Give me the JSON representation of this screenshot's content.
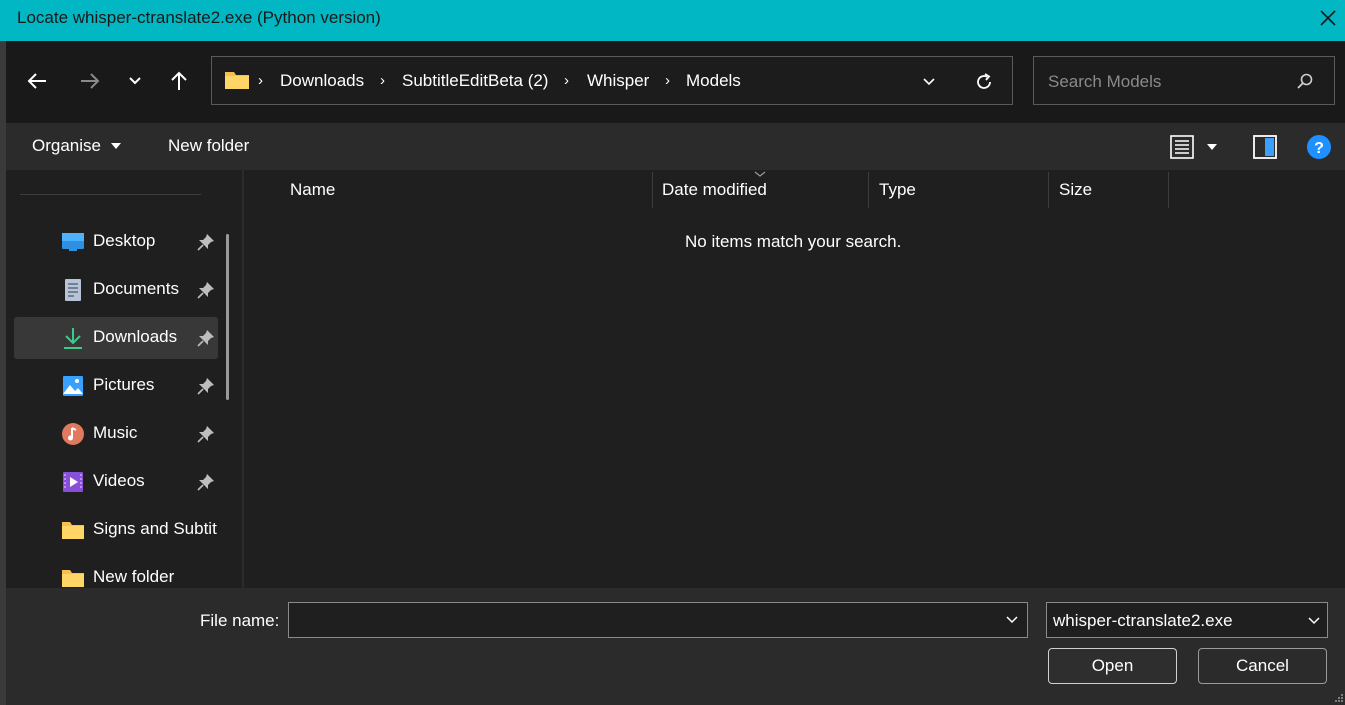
{
  "window": {
    "title": "Locate whisper-ctranslate2.exe (Python version)",
    "accent": "#00b7c3"
  },
  "nav": {
    "back_icon": "arrow-left-icon",
    "forward_icon": "arrow-right-icon",
    "recent_icon": "chevron-down-icon",
    "up_icon": "arrow-up-icon"
  },
  "address": {
    "crumbs": [
      "Downloads",
      "SubtitleEditBeta (2)",
      "Whisper",
      "Models"
    ]
  },
  "search": {
    "placeholder": "Search Models"
  },
  "toolbar": {
    "organise_label": "Organise",
    "new_folder_label": "New folder"
  },
  "sidebar": {
    "items": [
      {
        "label": "Desktop",
        "icon": "desktop-icon",
        "pinned": true
      },
      {
        "label": "Documents",
        "icon": "documents-icon",
        "pinned": true
      },
      {
        "label": "Downloads",
        "icon": "downloads-icon",
        "pinned": true,
        "selected": true
      },
      {
        "label": "Pictures",
        "icon": "pictures-icon",
        "pinned": true
      },
      {
        "label": "Music",
        "icon": "music-icon",
        "pinned": true
      },
      {
        "label": "Videos",
        "icon": "videos-icon",
        "pinned": true
      },
      {
        "label": "Signs and Subtit",
        "icon": "folder-icon",
        "pinned": false
      },
      {
        "label": "New folder",
        "icon": "folder-icon",
        "pinned": false
      }
    ]
  },
  "content": {
    "columns": [
      "Name",
      "Date modified",
      "Type",
      "Size"
    ],
    "empty_message": "No items match your search."
  },
  "bottom": {
    "filename_label": "File name:",
    "filename_value": "",
    "filter_value": "whisper-ctranslate2.exe",
    "open_label": "Open",
    "cancel_label": "Cancel"
  }
}
